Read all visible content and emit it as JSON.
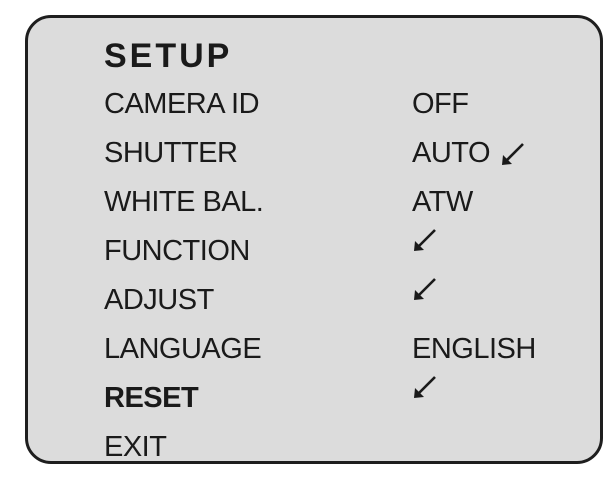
{
  "menu": {
    "title": "SETUP",
    "items": [
      {
        "label": "CAMERA ID",
        "value": "OFF",
        "submenu_icon": false
      },
      {
        "label": "SHUTTER",
        "value": "AUTO",
        "submenu_icon": true
      },
      {
        "label": "WHITE BAL.",
        "value": "ATW",
        "submenu_icon": false
      },
      {
        "label": "FUNCTION",
        "value": "",
        "submenu_icon": true
      },
      {
        "label": "ADJUST",
        "value": "",
        "submenu_icon": true
      },
      {
        "label": "LANGUAGE",
        "value": "ENGLISH",
        "submenu_icon": false
      },
      {
        "label": "RESET",
        "value": "",
        "submenu_icon": true,
        "selected": true
      },
      {
        "label": "EXIT",
        "value": "",
        "submenu_icon": false
      }
    ]
  },
  "icons": {
    "submenu": "submenu-arrow-icon"
  },
  "colors": {
    "panel_background": "#dcdcdc",
    "text": "#1a1a1a",
    "border": "#1e1e1e"
  }
}
